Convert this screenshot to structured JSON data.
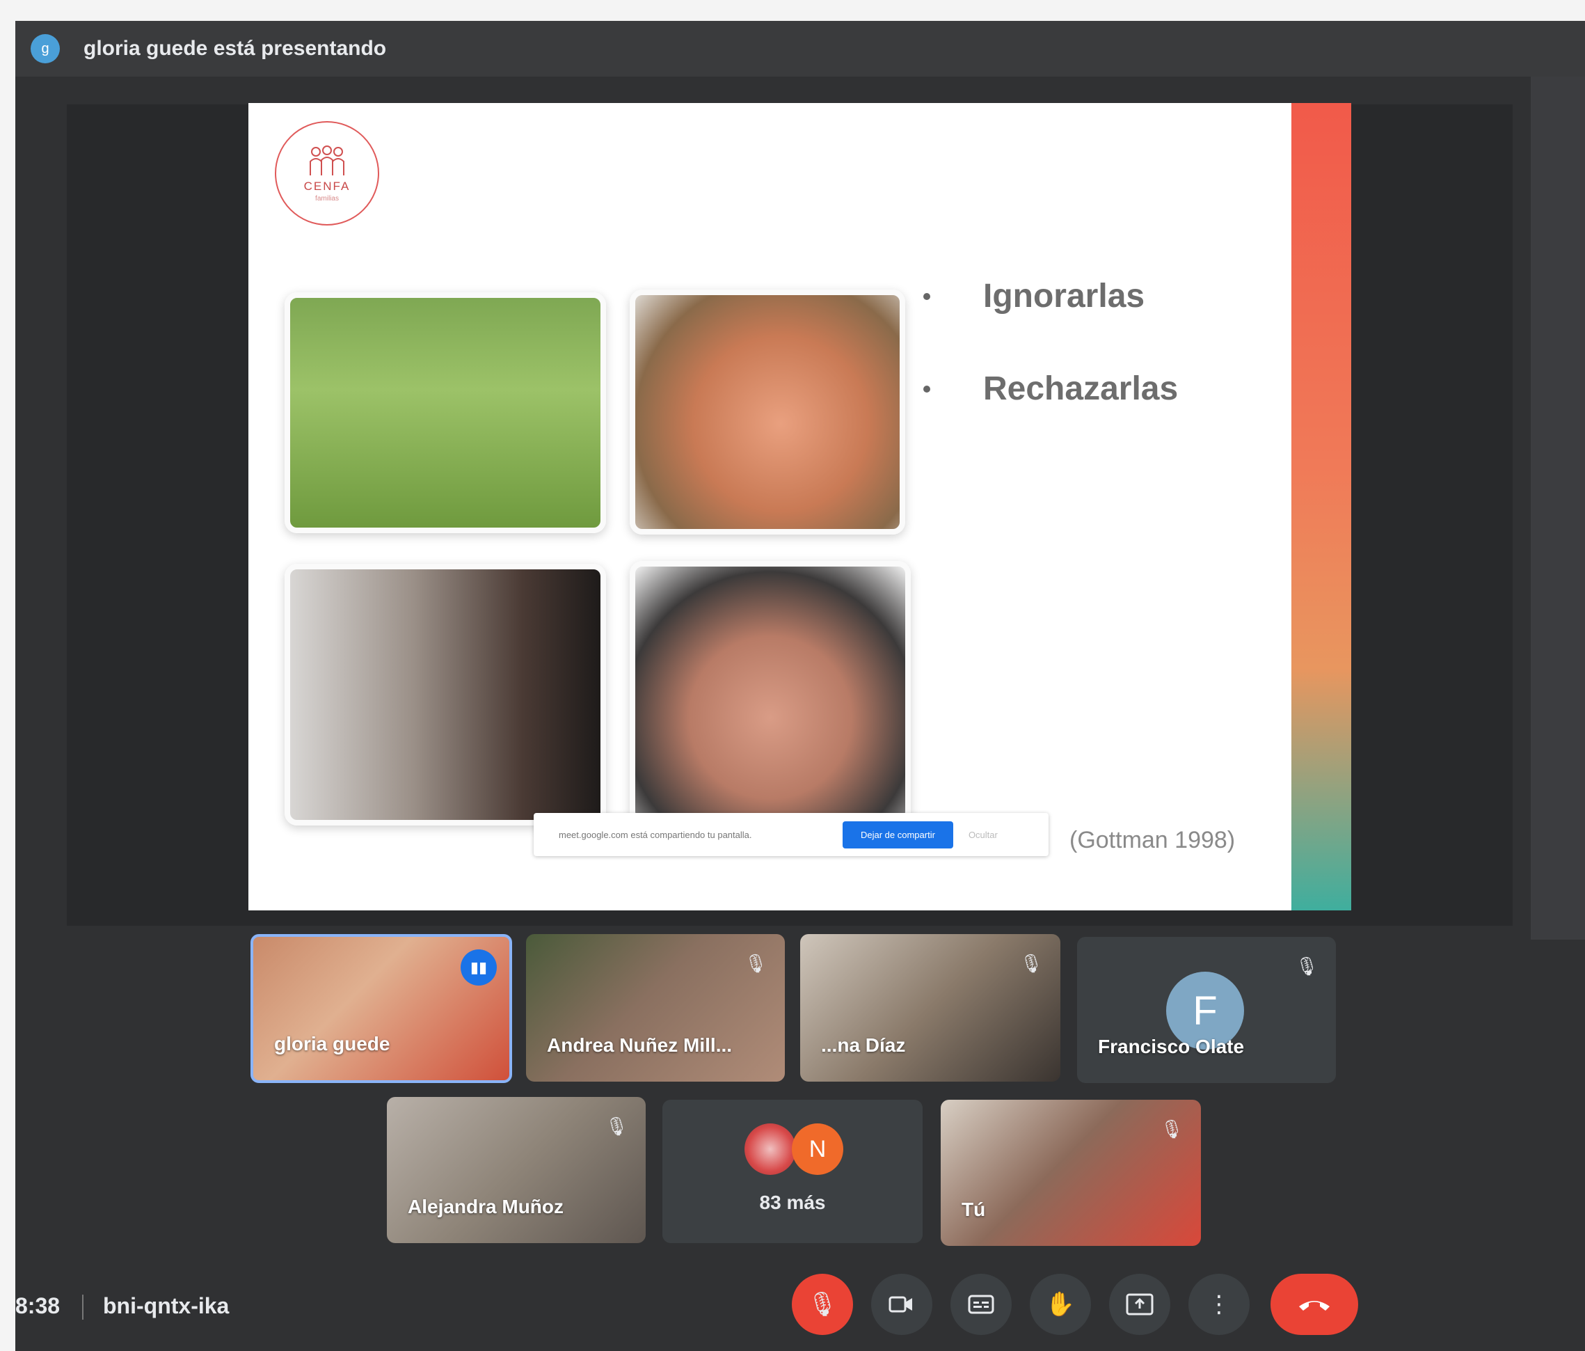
{
  "topbar": {
    "avatar_letter": "g",
    "presenter_text": "gloria guede está presentando"
  },
  "slide": {
    "logo_name": "CENFA",
    "logo_sub": "familias",
    "bullets": [
      "Ignorarlas",
      "Rechazarlas"
    ],
    "citation": "(Gottman 1998)",
    "share_bar": {
      "text": "meet.google.com está compartiendo tu pantalla.",
      "stop_label": "Dejar de compartir",
      "hide_label": "Ocultar"
    }
  },
  "participants": [
    {
      "name": "gloria guede"
    },
    {
      "name": "Andrea Nuñez Mill..."
    },
    {
      "name": "...na Díaz"
    },
    {
      "name": "Francisco Olate",
      "avatar_letter": "F"
    },
    {
      "name": "Alejandra Muñoz"
    },
    {
      "name": "83 más",
      "avatar_letter": "N"
    },
    {
      "name": "Tú"
    }
  ],
  "bottombar": {
    "clock": "8:38",
    "meeting_code": "bni-qntx-ika"
  },
  "colors": {
    "accent_blue": "#1a73e8",
    "danger_red": "#ea4335",
    "tile_bg": "#3c4043"
  },
  "icons": {
    "mic_off": "mic-off-icon",
    "camera": "camera-icon",
    "captions": "captions-icon",
    "raise_hand": "raise-hand-icon",
    "present": "present-icon",
    "more": "more-vert-icon",
    "hangup": "hangup-icon"
  }
}
